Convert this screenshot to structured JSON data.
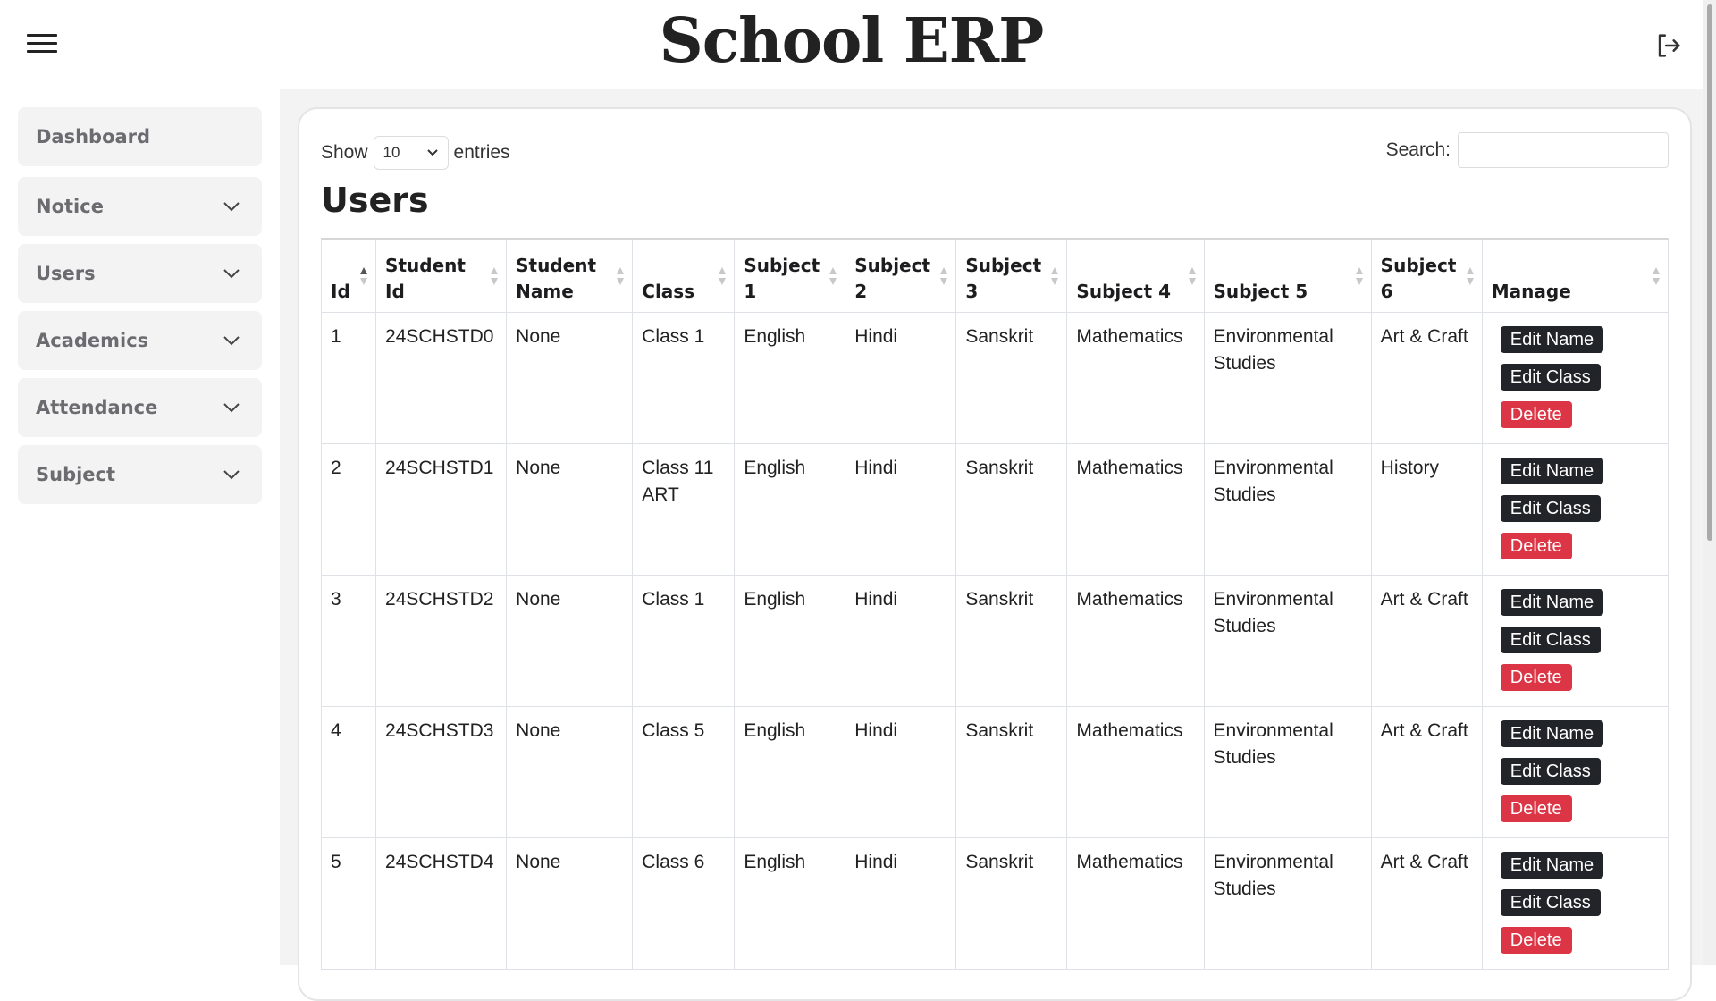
{
  "header": {
    "title": "School ERP"
  },
  "sidebar": {
    "items": [
      {
        "label": "Dashboard",
        "has_chevron": false
      },
      {
        "label": "Notice",
        "has_chevron": true
      },
      {
        "label": "Users",
        "has_chevron": true
      },
      {
        "label": "Academics",
        "has_chevron": true
      },
      {
        "label": "Attendance",
        "has_chevron": true
      },
      {
        "label": "Subject",
        "has_chevron": true
      }
    ]
  },
  "controls": {
    "show_label": "Show",
    "entries_value": "10",
    "entries_label": "entries",
    "search_label": "Search:",
    "search_value": ""
  },
  "section_title": "Users",
  "table": {
    "headers": [
      "Id",
      "Student Id",
      "Student Name",
      "Class",
      "Subject 1",
      "Subject 2",
      "Subject 3",
      "Subject 4",
      "Subject 5",
      "Subject 6",
      "Manage"
    ],
    "rows": [
      [
        "1",
        "24SCHSTD0",
        "None",
        "Class 1",
        "English",
        "Hindi",
        "Sanskrit",
        "Mathematics",
        "Environmental Studies",
        "Art & Craft"
      ],
      [
        "2",
        "24SCHSTD1",
        "None",
        "Class 11 ART",
        "English",
        "Hindi",
        "Sanskrit",
        "Mathematics",
        "Environmental Studies",
        "History"
      ],
      [
        "3",
        "24SCHSTD2",
        "None",
        "Class 1",
        "English",
        "Hindi",
        "Sanskrit",
        "Mathematics",
        "Environmental Studies",
        "Art & Craft"
      ],
      [
        "4",
        "24SCHSTD3",
        "None",
        "Class 5",
        "English",
        "Hindi",
        "Sanskrit",
        "Mathematics",
        "Environmental Studies",
        "Art & Craft"
      ],
      [
        "5",
        "24SCHSTD4",
        "None",
        "Class 6",
        "English",
        "Hindi",
        "Sanskrit",
        "Mathematics",
        "Environmental Studies",
        "Art & Craft"
      ]
    ],
    "actions": {
      "edit_name": "Edit Name",
      "edit_class": "Edit Class",
      "delete": "Delete"
    }
  },
  "colors": {
    "danger": "#dc3545",
    "dark": "#212529",
    "panel": "#f3f3f4"
  }
}
